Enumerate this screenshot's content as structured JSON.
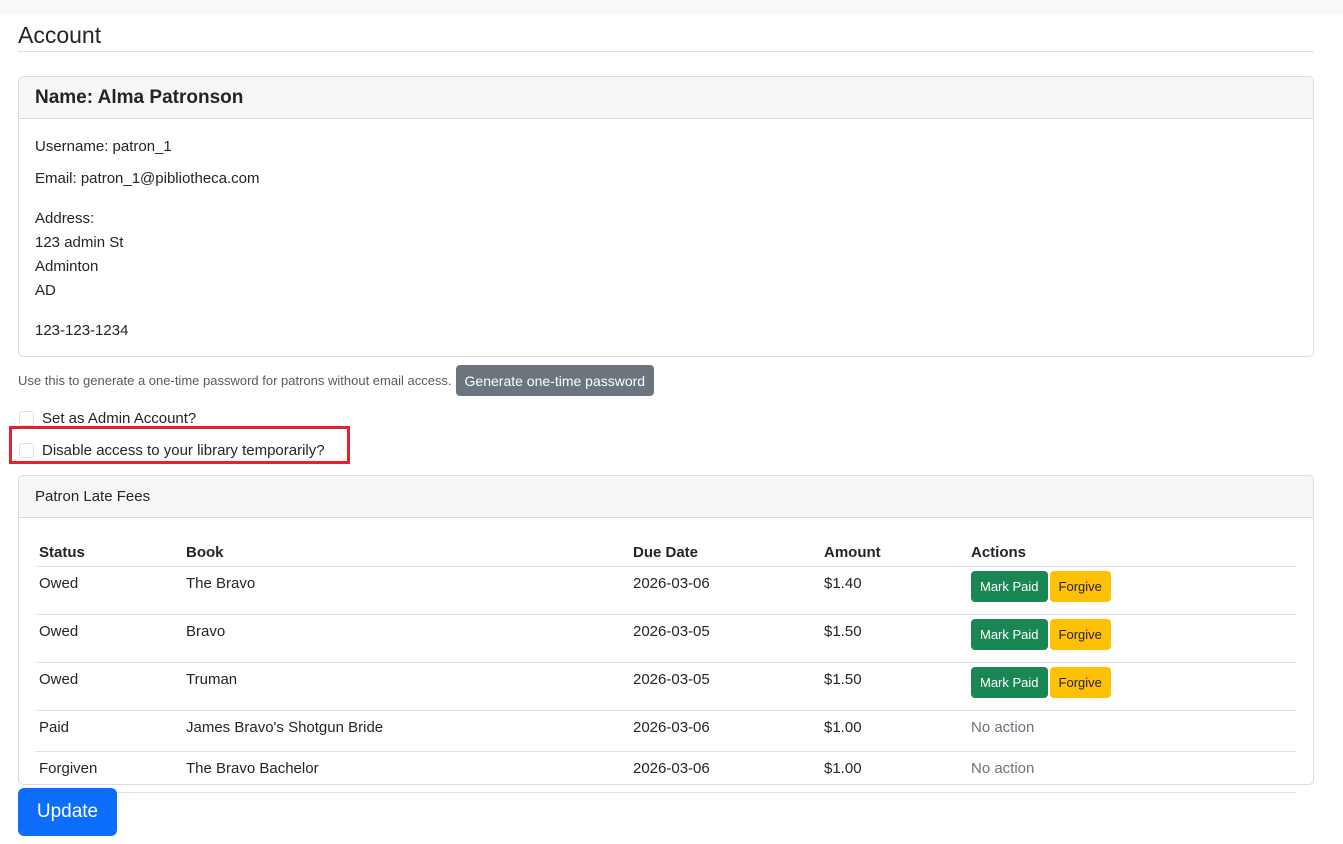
{
  "page": {
    "title": "Account"
  },
  "account": {
    "name_label": "Name: Alma Patronson",
    "username_line": "Username: patron_1",
    "email_line": "Email: patron_1@pibliotheca.com",
    "address_label": "Address:",
    "address_line1": "123 admin St",
    "address_line2": "Adminton",
    "address_line3": "AD",
    "phone": "123-123-1234"
  },
  "otp": {
    "help_text": "Use this to generate a one-time password for patrons without email access.",
    "button_label": "Generate one-time password"
  },
  "options": {
    "admin_label": "Set as Admin Account?",
    "admin_checked": false,
    "disable_label": "Disable access to your library temporarily?",
    "disable_checked": false
  },
  "fees": {
    "header": "Patron Late Fees",
    "columns": [
      "Status",
      "Book",
      "Due Date",
      "Amount",
      "Actions"
    ],
    "rows": [
      {
        "status": "Owed",
        "book": "The Bravo",
        "due": "2026-03-06",
        "amount": "$1.40",
        "mark_paid": "Mark Paid",
        "forgive": "Forgive"
      },
      {
        "status": "Owed",
        "book": "Bravo",
        "due": "2026-03-05",
        "amount": "$1.50",
        "mark_paid": "Mark Paid",
        "forgive": "Forgive"
      },
      {
        "status": "Owed",
        "book": "Truman",
        "due": "2026-03-05",
        "amount": "$1.50",
        "mark_paid": "Mark Paid",
        "forgive": "Forgive"
      },
      {
        "status": "Paid",
        "book": "James Bravo's Shotgun Bride",
        "due": "2026-03-06",
        "amount": "$1.00",
        "no_action": "No action"
      },
      {
        "status": "Forgiven",
        "book": "The Bravo Bachelor",
        "due": "2026-03-06",
        "amount": "$1.00",
        "no_action": "No action"
      }
    ]
  },
  "actions": {
    "update_label": "Update"
  },
  "colors": {
    "primary": "#0d6efd",
    "success": "#198754",
    "warning": "#ffc107",
    "secondary": "#6c757d",
    "highlight": "#e3222b"
  }
}
